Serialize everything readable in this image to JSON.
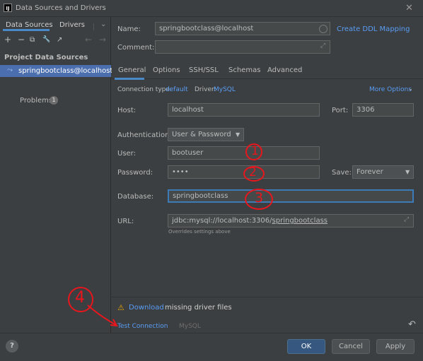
{
  "window": {
    "title": "Data Sources and Drivers",
    "close_icon": "✕"
  },
  "left": {
    "tabs": [
      "Data Sources",
      "Drivers"
    ],
    "toolbar_icons": [
      "+",
      "−",
      "⧉",
      "🔧",
      "↗",
      "←",
      "→"
    ],
    "section_title": "Project Data Sources",
    "selected_item": "springbootclass@localhost",
    "problems_label": "Problems",
    "problems_count": "1"
  },
  "form": {
    "name_label": "Name:",
    "name_value": "springbootclass@localhost",
    "create_ddl": "Create DDL Mapping",
    "comment_label": "Comment:",
    "tabs": [
      "General",
      "Options",
      "SSH/SSL",
      "Schemas",
      "Advanced"
    ],
    "connection_type_label": "Connection type:",
    "connection_type_value": "default",
    "driver_label": "Driver:",
    "driver_value": "MySQL",
    "more_options": "More Options",
    "host_label": "Host:",
    "host_value": "localhost",
    "port_label": "Port:",
    "port_value": "3306",
    "auth_label": "Authentication:",
    "auth_value": "User & Password",
    "user_label": "User:",
    "user_value": "bootuser",
    "password_label": "Password:",
    "password_value": "••••",
    "save_label": "Save:",
    "save_value": "Forever",
    "database_label": "Database:",
    "database_value": "springbootclass",
    "url_label": "URL:",
    "url_prefix": "jdbc:mysql://localhost:3306/",
    "url_db": "springbootclass",
    "url_note": "Overrides settings above"
  },
  "bottom": {
    "warning_link": "Download",
    "warning_text": "missing driver files",
    "test_connection": "Test Connection",
    "driver_name": "MySQL",
    "undo_icon": "↶"
  },
  "footer": {
    "help": "?",
    "ok": "OK",
    "cancel": "Cancel",
    "apply": "Apply"
  },
  "annotations": {
    "one": "1",
    "two": "2",
    "three": "3",
    "four": "4"
  },
  "colors": {
    "accent": "#589df6",
    "selection": "#4b6eaf",
    "annotation": "#e8161d",
    "warning": "#e5a50a"
  }
}
